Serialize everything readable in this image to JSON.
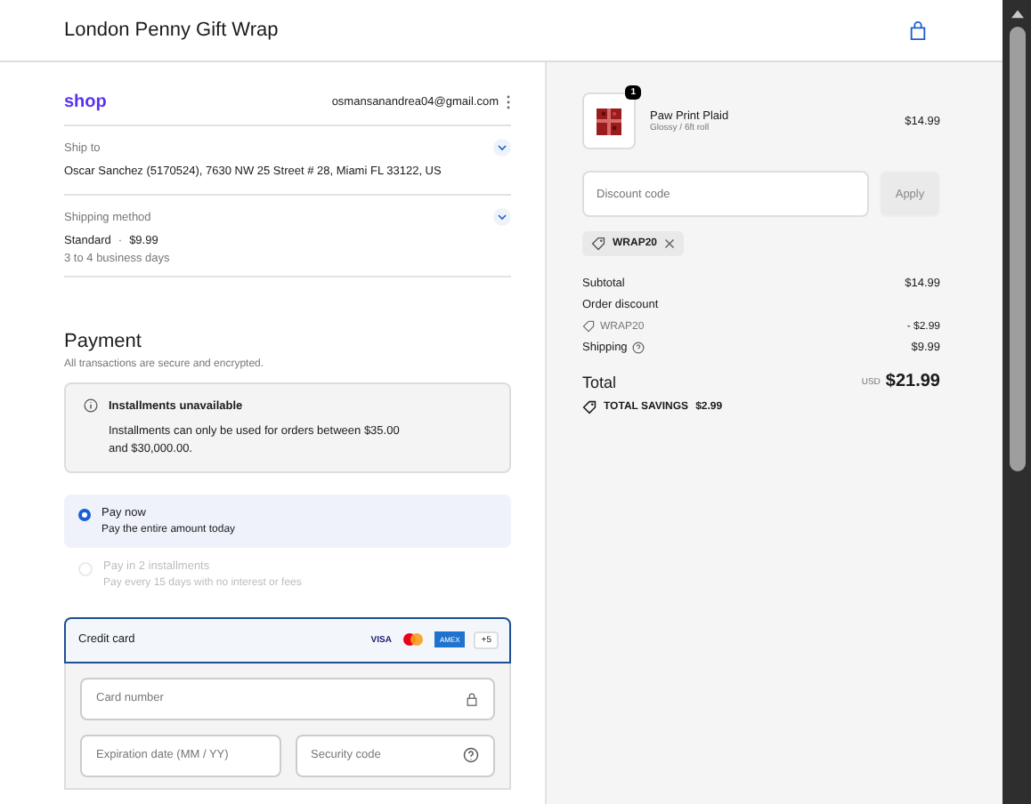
{
  "header": {
    "title": "London Penny Gift Wrap"
  },
  "contact": {
    "logo": "shop",
    "email": "osmansanandrea04@gmail.com"
  },
  "ship_to": {
    "label": "Ship to",
    "value": "Oscar Sanchez (5170524), 7630 NW 25 Street # 28, Miami FL 33122, US"
  },
  "shipping_method": {
    "label": "Shipping method",
    "name": "Standard",
    "separator": "·",
    "price": "$9.99",
    "note": "3 to 4 business days"
  },
  "payment": {
    "title": "Payment",
    "subtitle": "All transactions are secure and encrypted.",
    "notice": {
      "title": "Installments unavailable",
      "body": "Installments can only be used for orders between $35.00 and $30,000.00."
    },
    "options": [
      {
        "label": "Pay now",
        "sub": "Pay the entire amount today",
        "selected": true,
        "disabled": false
      },
      {
        "label": "Pay in 2 installments",
        "sub": "Pay every 15 days with no interest or fees",
        "selected": false,
        "disabled": true
      }
    ],
    "method": {
      "label": "Credit card",
      "brands": [
        {
          "kind": "visa",
          "text": "VISA"
        },
        {
          "kind": "mastercard"
        },
        {
          "kind": "amex",
          "text": "AMEX"
        },
        {
          "kind": "more",
          "text": "+5"
        }
      ]
    },
    "fields": [
      {
        "placeholder": "Card number",
        "kind": "lock"
      },
      {
        "placeholder": "Expiration date (MM / YY)"
      },
      {
        "placeholder": "Security code",
        "kind": "help"
      }
    ]
  },
  "summary": {
    "item": {
      "name": "Paw Print Plaid",
      "variant": "Glossy / 6ft roll",
      "quantity": "1",
      "price": "$14.99"
    },
    "discount": {
      "placeholder": "Discount code",
      "button": "Apply",
      "tag": "WRAP20"
    },
    "rows": [
      {
        "kind": "line",
        "label": "Subtotal",
        "value": "$14.99"
      },
      {
        "kind": "heading",
        "label": "Order discount"
      },
      {
        "kind": "code",
        "label": "WRAP20",
        "value": "- $2.99"
      },
      {
        "kind": "help",
        "label": "Shipping",
        "value": "$9.99"
      }
    ],
    "total": {
      "label": "Total",
      "currency": "USD",
      "value": "$21.99"
    },
    "savings": {
      "label": "TOTAL SAVINGS",
      "value": "$2.99"
    }
  }
}
